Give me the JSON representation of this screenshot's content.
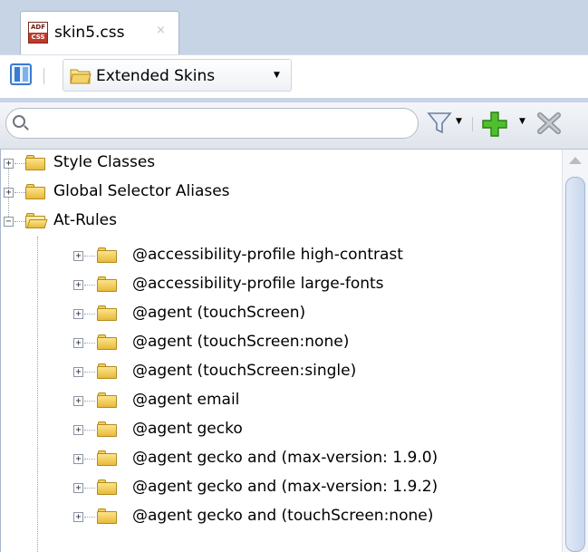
{
  "tab": {
    "file_icon_top": "ADF",
    "file_icon_bottom": "CSS",
    "title": "skin5.css",
    "close": "×"
  },
  "toolbar": {
    "split_icon": "split-view-icon",
    "skins_dropdown_label": "Extended Skins",
    "skins_caret": "▼"
  },
  "search": {
    "value": "",
    "placeholder": ""
  },
  "actions": {
    "filter_caret": "▼",
    "add_caret": "▼"
  },
  "tree": {
    "top_level": [
      {
        "label": "Style Classes",
        "expander": "+"
      },
      {
        "label": "Global Selector Aliases",
        "expander": "+"
      },
      {
        "label": "At-Rules",
        "expander": "−"
      }
    ],
    "at_rules": [
      {
        "label": "@accessibility-profile high-contrast",
        "expander": "+"
      },
      {
        "label": "@accessibility-profile large-fonts",
        "expander": "+"
      },
      {
        "label": "@agent (touchScreen)",
        "expander": "+"
      },
      {
        "label": "@agent (touchScreen:none)",
        "expander": "+"
      },
      {
        "label": "@agent (touchScreen:single)",
        "expander": "+"
      },
      {
        "label": "@agent email",
        "expander": "+"
      },
      {
        "label": "@agent gecko",
        "expander": "+"
      },
      {
        "label": "@agent gecko and (max-version: 1.9.0)",
        "expander": "+"
      },
      {
        "label": "@agent gecko and (max-version: 1.9.2)",
        "expander": "+"
      },
      {
        "label": "@agent gecko and (touchScreen:none)",
        "expander": "+"
      }
    ]
  }
}
